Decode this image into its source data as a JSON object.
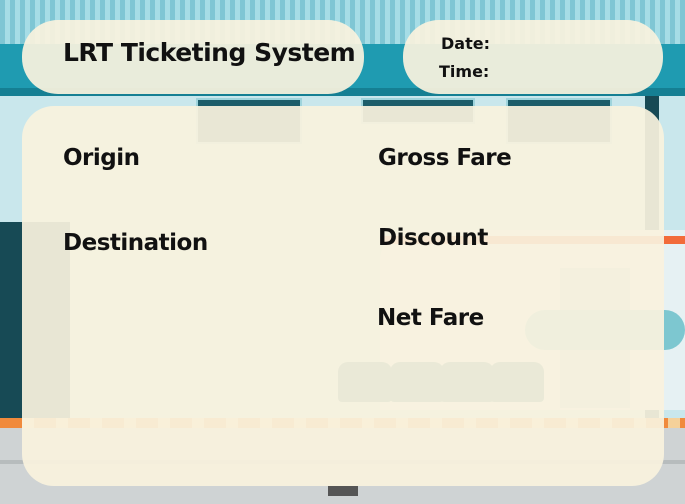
{
  "header": {
    "title": "LRT Ticketing System"
  },
  "datetime": {
    "date_label": "Date:",
    "time_label": "Time:"
  },
  "form": {
    "origin_label": "Origin",
    "destination_label": "Destination",
    "gross_fare_label": "Gross Fare",
    "discount_label": "Discount",
    "net_fare_label": "Net Fare"
  },
  "colors": {
    "card_background": "#f9f2de",
    "text": "#111111",
    "station_accent": "#1f9bb1",
    "platform_stripe": "#f08a3c"
  }
}
